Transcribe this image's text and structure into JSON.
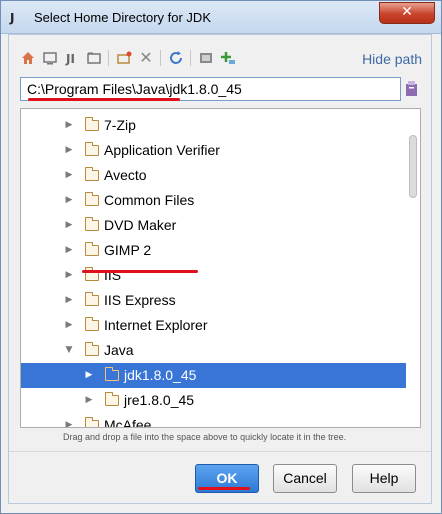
{
  "window": {
    "app_icon": "J",
    "title": "Select Home Directory for JDK",
    "close_symbol": "✕"
  },
  "toolbar": {
    "icons": [
      "home-icon",
      "desktop-icon",
      "project-icon",
      "module-icon",
      "new-folder-icon",
      "delete-icon",
      "refresh-icon",
      "show-hidden-icon",
      "new-dir-icon"
    ],
    "hide_path_label": "Hide path"
  },
  "path_field": {
    "value": "C:\\Program Files\\Java\\jdk1.8.0_45"
  },
  "tree": {
    "items": [
      {
        "label": "7-Zip",
        "level": 1,
        "expanded": false,
        "selected": false
      },
      {
        "label": "Application Verifier",
        "level": 1,
        "expanded": false,
        "selected": false
      },
      {
        "label": "Avecto",
        "level": 1,
        "expanded": false,
        "selected": false
      },
      {
        "label": "Common Files",
        "level": 1,
        "expanded": false,
        "selected": false
      },
      {
        "label": "DVD Maker",
        "level": 1,
        "expanded": false,
        "selected": false
      },
      {
        "label": "GIMP 2",
        "level": 1,
        "expanded": false,
        "selected": false
      },
      {
        "label": "IIS",
        "level": 1,
        "expanded": false,
        "selected": false
      },
      {
        "label": "IIS Express",
        "level": 1,
        "expanded": false,
        "selected": false
      },
      {
        "label": "Internet Explorer",
        "level": 1,
        "expanded": false,
        "selected": false
      },
      {
        "label": "Java",
        "level": 1,
        "expanded": true,
        "selected": false
      },
      {
        "label": "jdk1.8.0_45",
        "level": 2,
        "expanded": false,
        "selected": true
      },
      {
        "label": "jre1.8.0_45",
        "level": 2,
        "expanded": false,
        "selected": false
      },
      {
        "label": "McAfee",
        "level": 1,
        "expanded": false,
        "selected": false
      }
    ]
  },
  "hint": "Drag and drop a file into the space above to quickly locate it in the tree.",
  "buttons": {
    "ok": "OK",
    "cancel": "Cancel",
    "help": "Help"
  },
  "colors": {
    "selection": "#3875d7",
    "accent_link": "#3d6aa6",
    "annotation_red": "#e0101a",
    "ok_button": "#2e79d4"
  }
}
